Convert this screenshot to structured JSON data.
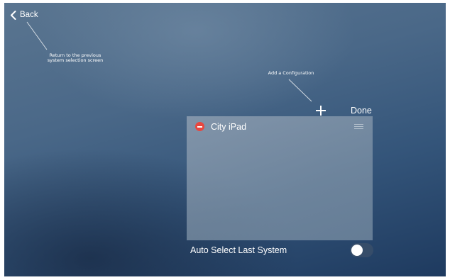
{
  "header": {
    "back_label": "Back",
    "back_icon": "chevron-left-icon"
  },
  "annotations": {
    "back_line1": "Return to the previous",
    "back_line2": "system selection screen",
    "add_config": "Add a Configuration"
  },
  "toolbar": {
    "add_icon": "plus-icon",
    "done_label": "Done"
  },
  "configurations": [
    {
      "name": "City iPad",
      "delete_icon": "minus-circle-icon",
      "handle_icon": "drag-handle-icon"
    }
  ],
  "settings": {
    "auto_select_label": "Auto Select Last System",
    "auto_select_enabled": false
  },
  "colors": {
    "delete": "#e8473f",
    "background_top": "#5a7590",
    "background_bottom": "#1e3a5f"
  }
}
